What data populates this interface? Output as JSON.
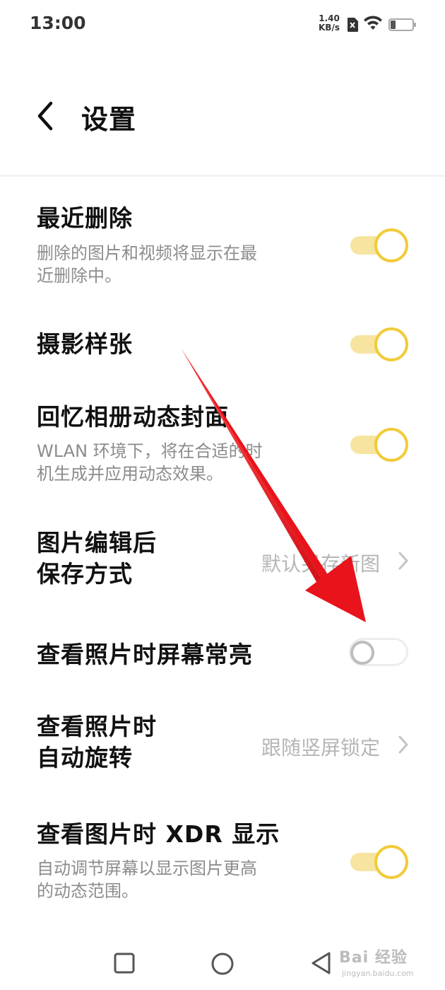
{
  "status_bar": {
    "time": "13:00",
    "net_speed_value": "1.40",
    "net_speed_unit": "KB/s",
    "icons": [
      "sim-off-icon",
      "wifi-icon",
      "battery-icon"
    ]
  },
  "header": {
    "back_icon": "chevron-left-icon",
    "title": "设置"
  },
  "settings": [
    {
      "title": "最近删除",
      "description": [
        "删除的图片和视频将显示在最",
        "近删除中。"
      ],
      "control": "toggle",
      "enabled": true
    },
    {
      "title": "摄影样张",
      "control": "toggle",
      "enabled": true
    },
    {
      "title": "回忆相册动态封面",
      "description": [
        "WLAN 环境下，将在合适的时",
        "机生成并应用动态效果。"
      ],
      "control": "toggle",
      "enabled": true
    },
    {
      "title_lines": [
        "图片编辑后",
        "保存方式"
      ],
      "value": "默认另存新图",
      "control": "chevron"
    },
    {
      "title": "查看照片时屏幕常亮",
      "control": "toggle",
      "enabled": false
    },
    {
      "title_lines": [
        "查看照片时",
        "自动旋转"
      ],
      "value": "跟随竖屏锁定",
      "control": "chevron"
    },
    {
      "title": "查看图片时 XDR 显示",
      "description": [
        "自动调节屏幕以显示图片更高",
        "的动态范围。"
      ],
      "control": "toggle",
      "enabled": true
    }
  ],
  "nav_bar": {
    "icons": [
      "recents-square-icon",
      "home-circle-icon",
      "back-triangle-icon"
    ]
  },
  "watermark": {
    "main": "Bai 经验",
    "sub": "jingyan.baidu.com"
  },
  "colors": {
    "accent": "#f1cb39",
    "toggle_track_on": "#f7e4a0",
    "arrow": "#e8131b"
  }
}
